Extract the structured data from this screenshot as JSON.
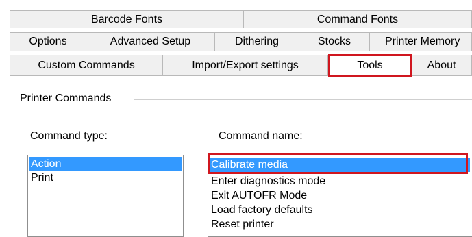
{
  "tabs": {
    "row1": [
      "Barcode Fonts",
      "Command Fonts"
    ],
    "row2": [
      "Options",
      "Advanced Setup",
      "Dithering",
      "Stocks",
      "Printer Memory"
    ],
    "row3": [
      "Custom Commands",
      "Import/Export settings",
      "Tools",
      "About"
    ],
    "selected": "Tools"
  },
  "group": {
    "title": "Printer Commands"
  },
  "command_type": {
    "label": "Command type:",
    "items": [
      "Action",
      "Print"
    ],
    "selected": "Action"
  },
  "command_name": {
    "label": "Command name:",
    "items": [
      "Calibrate media",
      "Enter diagnostics mode",
      "Exit AUTOFR Mode",
      "Load factory defaults",
      "Reset printer"
    ],
    "selected": "Calibrate media"
  },
  "colors": {
    "selection": "#3399ff",
    "highlight_annotation": "#d0161f"
  }
}
